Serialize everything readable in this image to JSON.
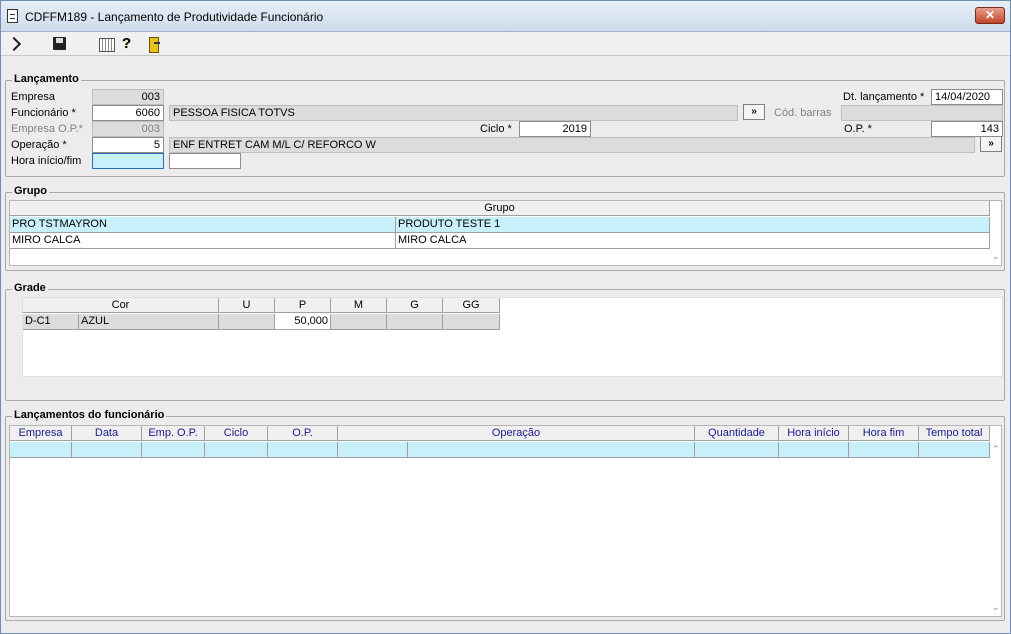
{
  "window": {
    "title": "CDFFM189 - Lançamento de Produtividade Funcionário",
    "close_label": "✕"
  },
  "toolbar": {
    "help_glyph": "?"
  },
  "lancamento": {
    "section_label": "Lançamento",
    "empresa_label": "Empresa",
    "empresa_value": "003",
    "funcionario_label": "Funcionário *",
    "funcionario_code": "6060",
    "funcionario_name": "PESSOA FISICA TOTVS",
    "empresa_op_label": "Empresa O.P.*",
    "empresa_op_value": "003",
    "operacao_label": "Operação *",
    "operacao_code": "5",
    "operacao_desc": "ENF ENTRET CAM M/L C/ REFORCO W",
    "hora_label": "Hora início/fim",
    "hora_inicio": "",
    "hora_fim": "",
    "dt_lancamento_label": "Dt. lançamento *",
    "dt_lancamento_value": "14/04/2020",
    "cod_barras_label": "Cód. barras",
    "cod_barras_value": "",
    "ciclo_label": "Ciclo *",
    "ciclo_value": "2019",
    "op_label": "O.P. *",
    "op_value": "143",
    "more_button": "»"
  },
  "grupo": {
    "section_label": "Grupo",
    "header": "Grupo",
    "rows": [
      {
        "code": "PRO TSTMAYRON",
        "desc": "PRODUTO TESTE 1"
      },
      {
        "code": "MIRO CALCA",
        "desc": "MIRO CALCA"
      }
    ],
    "scroll_down": "⌄"
  },
  "grade": {
    "section_label": "Grade",
    "columns": [
      "Cor",
      "U",
      "P",
      "M",
      "G",
      "GG"
    ],
    "row": {
      "code": "D-C1",
      "cor": "AZUL",
      "u": "",
      "p": "50,000",
      "m": "",
      "g": "",
      "gg": ""
    }
  },
  "lancamentos": {
    "section_label": "Lançamentos do funcionário",
    "columns": [
      "Empresa",
      "Data",
      "Emp. O.P.",
      "Ciclo",
      "O.P.",
      "Operação",
      "Quantidade",
      "Hora início",
      "Hora fim",
      "Tempo total"
    ],
    "scroll_up": "⌃",
    "scroll_down": "⌄"
  }
}
